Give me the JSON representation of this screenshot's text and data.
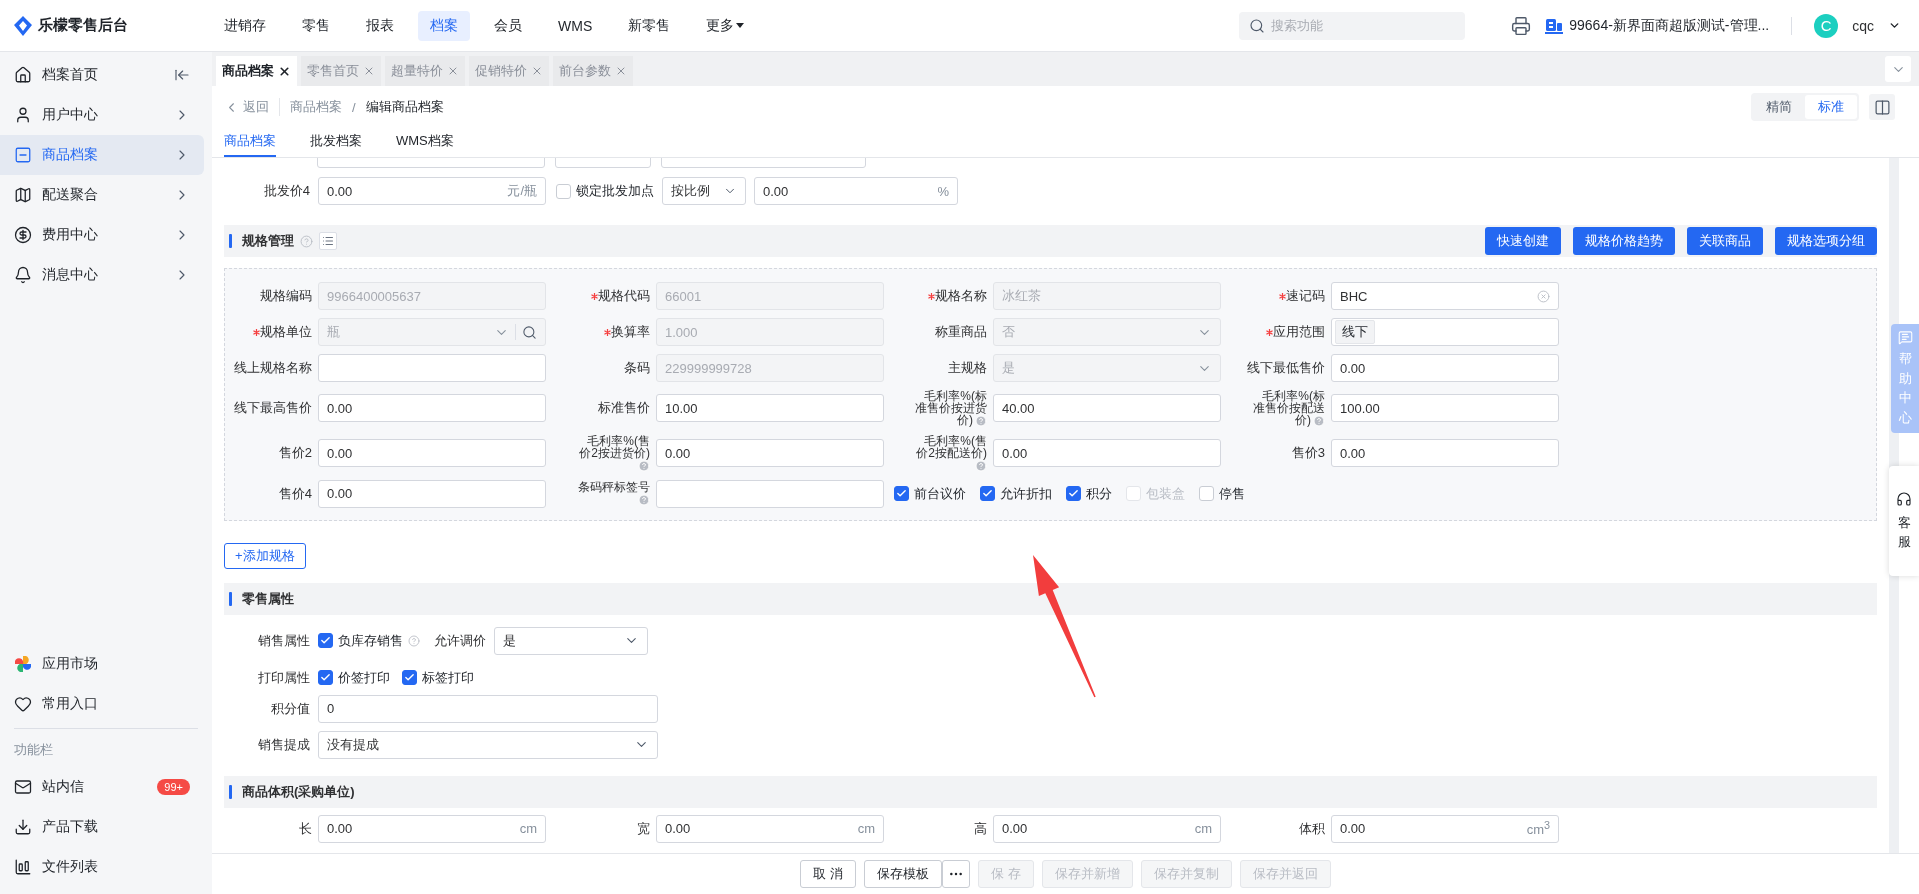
{
  "app": {
    "name": "乐檬零售后台"
  },
  "top_nav": [
    {
      "label": "进销存",
      "selected": false,
      "kind": "link"
    },
    {
      "label": "零售",
      "selected": false,
      "kind": "link"
    },
    {
      "label": "报表",
      "selected": false,
      "kind": "link"
    },
    {
      "label": "档案",
      "selected": true,
      "kind": "link"
    },
    {
      "label": "会员",
      "selected": false,
      "kind": "link"
    },
    {
      "label": "WMS",
      "selected": false,
      "kind": "link"
    },
    {
      "label": "新零售",
      "selected": false,
      "kind": "link"
    },
    {
      "label": "更多",
      "selected": false,
      "kind": "menu"
    }
  ],
  "search": {
    "placeholder": "搜索功能"
  },
  "store": {
    "name": "99664-新界面商超版测试-管理..."
  },
  "user": {
    "avatar": "C",
    "name": "cqc"
  },
  "sidebar": {
    "items": [
      {
        "label": "档案首页",
        "selected": false,
        "kind": "collapse"
      },
      {
        "label": "用户中心",
        "selected": false,
        "kind": "submenu"
      },
      {
        "label": "商品档案",
        "selected": true,
        "kind": "submenu"
      },
      {
        "label": "配送聚合",
        "selected": false,
        "kind": "submenu"
      },
      {
        "label": "费用中心",
        "selected": false,
        "kind": "submenu"
      },
      {
        "label": "消息中心",
        "selected": false,
        "kind": "submenu"
      }
    ],
    "shortcuts": [
      {
        "label": "应用市场"
      },
      {
        "label": "常用入口"
      }
    ],
    "section": "功能栏",
    "tools": [
      {
        "label": "站内信",
        "badge": "99+"
      },
      {
        "label": "产品下载"
      },
      {
        "label": "文件列表"
      }
    ]
  },
  "tabs": [
    {
      "label": "商品档案",
      "selected": true
    },
    {
      "label": "零售首页",
      "selected": false
    },
    {
      "label": "超量特价",
      "selected": false
    },
    {
      "label": "促销特价",
      "selected": false
    },
    {
      "label": "前台参数",
      "selected": false
    }
  ],
  "breadcrumb": {
    "back": "返回",
    "parent": "商品档案",
    "separator": "/",
    "current": "编辑商品档案"
  },
  "view_modes": [
    {
      "label": "精简",
      "selected": false
    },
    {
      "label": "标准",
      "selected": true
    }
  ],
  "sub_tabs": [
    {
      "label": "商品档案",
      "selected": true
    },
    {
      "label": "批发档案",
      "selected": false
    },
    {
      "label": "WMS档案",
      "selected": false
    }
  ],
  "wholesale_row": {
    "label": "批发价4",
    "value": "0.00",
    "unit": "元/瓶",
    "lock": {
      "label": "锁定批发加点",
      "checked": false
    },
    "mode": "按比例",
    "markup": "0.00",
    "markup_unit": "%"
  },
  "spec_section": {
    "title": "规格管理",
    "buttons": [
      "快速创建",
      "规格价格趋势",
      "关联商品",
      "规格选项分组"
    ],
    "rows": [
      [
        {
          "label": "规格编码",
          "required": false,
          "help": false,
          "kind": "text",
          "disabled": true,
          "value": "9966400005637"
        },
        {
          "label": "规格代码",
          "required": true,
          "help": false,
          "kind": "text",
          "disabled": true,
          "value": "66001"
        },
        {
          "label": "规格名称",
          "required": true,
          "help": false,
          "kind": "text",
          "disabled": true,
          "value": "冰红茶"
        },
        {
          "label": "速记码",
          "required": true,
          "help": false,
          "kind": "clear",
          "disabled": false,
          "value": "BHC"
        }
      ],
      [
        {
          "label": "规格单位",
          "required": true,
          "help": false,
          "kind": "lookup",
          "disabled": true,
          "value": "瓶"
        },
        {
          "label": "换算率",
          "required": true,
          "help": false,
          "kind": "text",
          "disabled": true,
          "value": "1.000"
        },
        {
          "label": "称重商品",
          "required": false,
          "help": false,
          "kind": "select",
          "disabled": true,
          "value": "否"
        },
        {
          "label": "应用范围",
          "required": true,
          "help": false,
          "kind": "tag",
          "disabled": false,
          "value": "线下"
        }
      ],
      [
        {
          "label": "线上规格名称",
          "required": false,
          "help": false,
          "kind": "text",
          "disabled": false
        },
        {
          "label": "条码",
          "required": false,
          "help": false,
          "kind": "text",
          "disabled": true,
          "value": "229999999728"
        },
        {
          "label": "主规格",
          "required": false,
          "help": false,
          "kind": "select",
          "disabled": true,
          "value": "是"
        },
        {
          "label": "线下最低售价",
          "required": false,
          "help": false,
          "kind": "text",
          "disabled": false,
          "value": "0.00"
        }
      ],
      [
        {
          "label": "线下最高售价",
          "required": false,
          "help": false,
          "kind": "text",
          "disabled": false,
          "value": "0.00"
        },
        {
          "label": "标准售价",
          "required": false,
          "help": false,
          "kind": "text",
          "disabled": false,
          "value": "10.00"
        },
        {
          "label": "毛利率%(标准售价按进货价)",
          "required": false,
          "help": true,
          "kind": "text",
          "disabled": false,
          "value": "40.00"
        },
        {
          "label": "毛利率%(标准售价按配送价)",
          "required": false,
          "help": true,
          "kind": "text",
          "disabled": false,
          "value": "100.00"
        }
      ],
      [
        {
          "label": "售价2",
          "required": false,
          "help": false,
          "kind": "text",
          "disabled": false,
          "value": "0.00"
        },
        {
          "label": "毛利率%(售价2按进货价)",
          "required": false,
          "help": true,
          "kind": "text",
          "disabled": false,
          "value": "0.00"
        },
        {
          "label": "毛利率%(售价2按配送价)",
          "required": false,
          "help": true,
          "kind": "text",
          "disabled": false,
          "value": "0.00"
        },
        {
          "label": "售价3",
          "required": false,
          "help": false,
          "kind": "text",
          "disabled": false,
          "value": "0.00"
        }
      ],
      [
        {
          "label": "售价4",
          "required": false,
          "help": false,
          "kind": "text",
          "disabled": false,
          "value": "0.00"
        },
        {
          "label": "条码秤标签号",
          "required": false,
          "help": true,
          "kind": "text",
          "disabled": false
        }
      ]
    ],
    "options": [
      {
        "label": "前台议价",
        "checked": true,
        "disabled": false
      },
      {
        "label": "允许折扣",
        "checked": true,
        "disabled": false
      },
      {
        "label": "积分",
        "checked": true,
        "disabled": false
      },
      {
        "label": "包装盒",
        "checked": false,
        "disabled": true
      },
      {
        "label": "停售",
        "checked": false,
        "disabled": false
      }
    ],
    "add_button": "+添加规格"
  },
  "retail_section": {
    "title": "零售属性",
    "sale_attr": {
      "label": "销售属性",
      "option": {
        "label": "负库存销售",
        "checked": true
      },
      "price_adjust_label": "允许调价",
      "price_adjust": "是"
    },
    "print_attr": {
      "label": "打印属性",
      "options": [
        {
          "label": "价签打印",
          "checked": true
        },
        {
          "label": "标签打印",
          "checked": true
        }
      ]
    },
    "points": {
      "label": "积分值",
      "value": "0"
    },
    "commission": {
      "label": "销售提成",
      "value": "没有提成"
    }
  },
  "volume_section": {
    "title": "商品体积(采购单位)",
    "fields": [
      {
        "label": "长",
        "value": "0.00",
        "unit": "cm"
      },
      {
        "label": "宽",
        "value": "0.00",
        "unit": "cm"
      },
      {
        "label": "高",
        "value": "0.00",
        "unit": "cm"
      },
      {
        "label": "体积",
        "value": "0.00",
        "unit": "cm$^{3}$"
      }
    ]
  },
  "footer_buttons": [
    {
      "kind": "button",
      "label": "取 消",
      "disabled": false
    },
    {
      "kind": "button",
      "label": "保存模板",
      "disabled": false
    },
    {
      "kind": "more",
      "disabled": false
    },
    {
      "kind": "button",
      "label": "保 存",
      "disabled": true
    },
    {
      "kind": "button",
      "label": "保存并新增",
      "disabled": true
    },
    {
      "kind": "button",
      "label": "保存并复制",
      "disabled": true
    },
    {
      "kind": "button",
      "label": "保存并返回",
      "disabled": true
    }
  ],
  "help_panel": {
    "label": "帮助中心"
  },
  "service_panel": {
    "label": "客服"
  }
}
